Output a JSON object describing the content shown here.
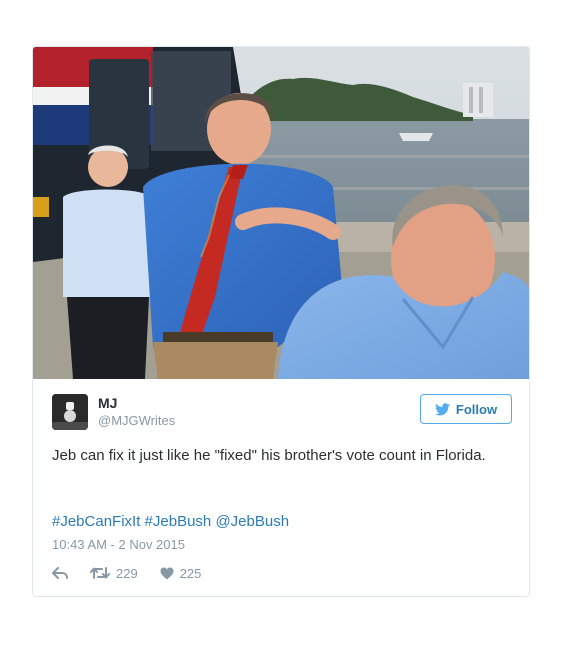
{
  "tweet": {
    "photo_icon": "photo",
    "author": {
      "display_name": "MJ",
      "handle": "@MJGWrites",
      "avatar_icon": "avatar"
    },
    "follow_label": "Follow",
    "follow_icon": "twitter-bird-icon",
    "text": "Jeb can fix it just like he \"fixed\" his brother's vote count in Florida.",
    "hashtags": [
      "#JebCanFixIt",
      "#JebBush",
      "@JebBush"
    ],
    "timestamp": "10:43 AM - 2 Nov 2015",
    "actions": {
      "reply_icon": "reply-icon",
      "retweet_icon": "retweet-icon",
      "retweet_count": "229",
      "like_icon": "heart-icon",
      "like_count": "225"
    }
  },
  "colors": {
    "link": "#2b7bb9",
    "follow_border": "#55acee",
    "muted": "#8899a6",
    "text": "#292f33",
    "border": "#e1e8ed"
  }
}
